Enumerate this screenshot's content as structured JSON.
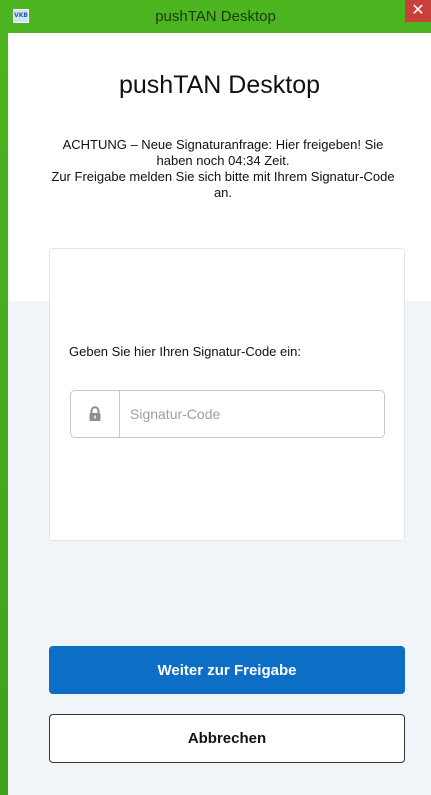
{
  "window": {
    "title": "pushTAN Desktop",
    "app_icon_text": "VKB",
    "close_symbol": "✕",
    "icons": [
      "app-icon",
      "close-icon",
      "lock-icon"
    ]
  },
  "main": {
    "heading": "pushTAN Desktop",
    "warning_line1": "ACHTUNG – Neue Signaturanfrage: Hier freigeben! Sie haben noch 04:34 Zeit.",
    "warning_line2": "Zur Freigabe melden Sie sich bitte mit Ihrem Signatur-Code an.",
    "prompt": "Geben Sie hier Ihren Signatur-Code ein:",
    "code_input": {
      "placeholder": "Signatur-Code",
      "value": ""
    }
  },
  "buttons": {
    "primary_label": "Weiter zur Freigabe",
    "secondary_label": "Abbrechen"
  },
  "colors": {
    "frame_green": "#3ea21a",
    "primary_blue": "#0d6ec6",
    "close_red": "#c9403a",
    "gray_background": "#f1f4f8"
  }
}
